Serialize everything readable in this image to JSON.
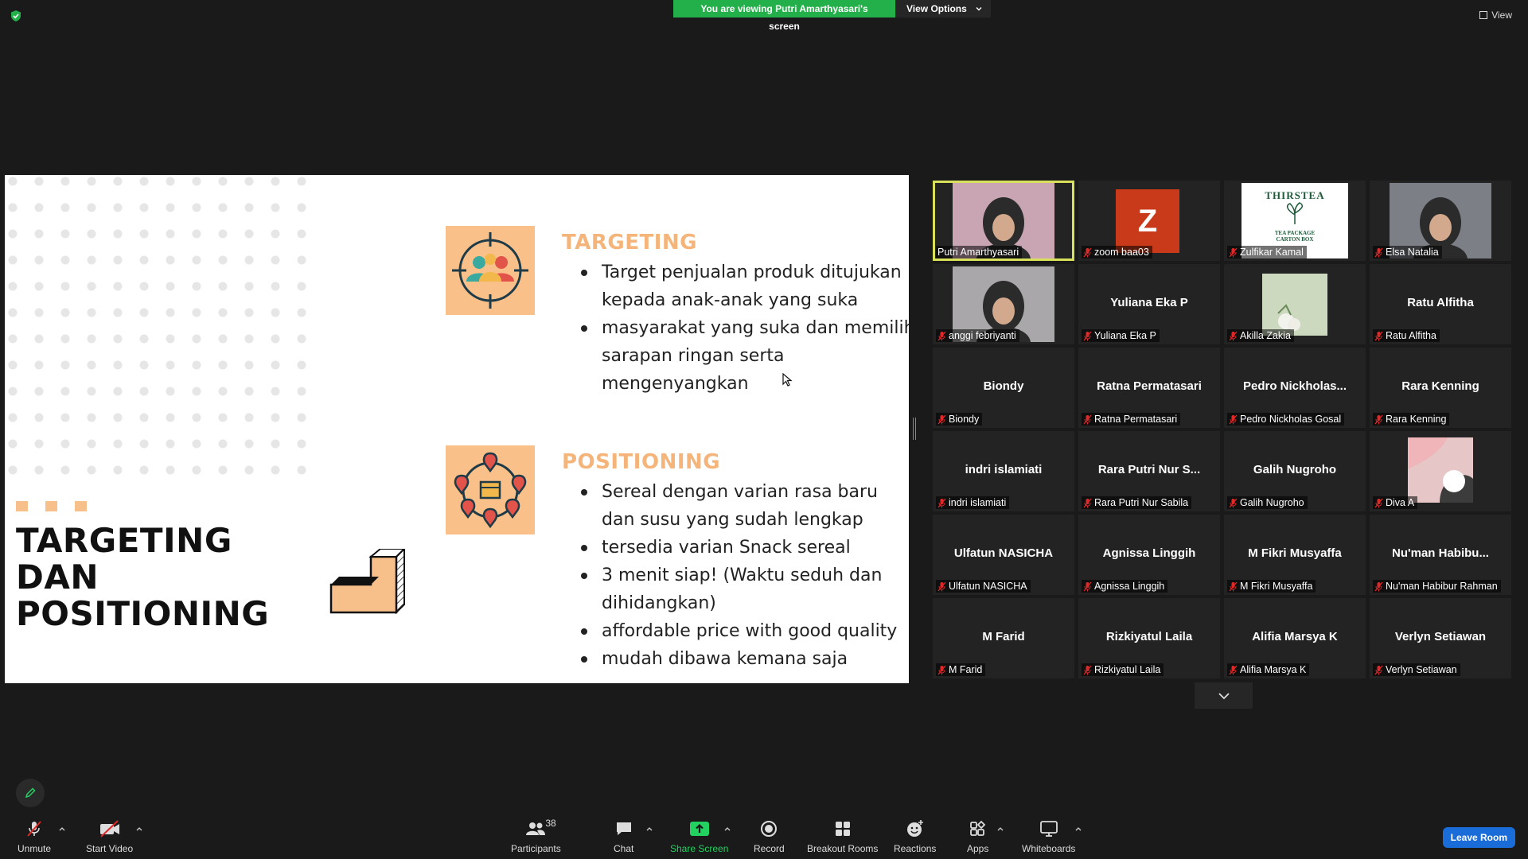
{
  "banner": {
    "viewing_text": "You are viewing Putri Amarthyasari's screen",
    "view_options_label": "View Options"
  },
  "top_right": {
    "view_label": "View"
  },
  "slide": {
    "title": "TARGETING DAN POSITIONING",
    "sections": [
      {
        "heading": "TARGETING",
        "bullets": [
          "Target penjualan produk ditujukan kepada anak-anak yang suka",
          "masyarakat yang suka dan memilih sarapan ringan serta mengenyangkan"
        ]
      },
      {
        "heading": "POSITIONING",
        "bullets": [
          "Sereal dengan varian rasa baru dan susu yang sudah lengkap",
          "tersedia varian Snack sereal",
          "3 menit siap! (Waktu seduh dan dihidangkan)",
          "affordable price with good quality",
          "mudah dibawa kemana saja"
        ]
      }
    ]
  },
  "participants": [
    {
      "label": "Putri Amarthyasari",
      "kind": "video",
      "active": true
    },
    {
      "label": "zoom baa03",
      "kind": "avatar",
      "avatar": "Z"
    },
    {
      "label": "Zulfikar Kamal",
      "kind": "image"
    },
    {
      "label": "Elsa Natalia",
      "kind": "video"
    },
    {
      "label": "anggi febriyanti",
      "kind": "video"
    },
    {
      "label": "Yuliana Eka P",
      "big": "Yuliana Eka P",
      "kind": "name"
    },
    {
      "label": "Akilla Zakia",
      "kind": "image2"
    },
    {
      "label": "Ratu Alfitha",
      "big": "Ratu Alfitha",
      "kind": "name"
    },
    {
      "label": "Biondy",
      "big": "Biondy",
      "kind": "name"
    },
    {
      "label": "Ratna Permatasari",
      "big": "Ratna Permatasari",
      "kind": "name"
    },
    {
      "label": "Pedro Nickholas Gosal",
      "big": "Pedro  Nickholas...",
      "kind": "name"
    },
    {
      "label": "Rara Kenning",
      "big": "Rara Kenning",
      "kind": "name"
    },
    {
      "label": "indri islamiati",
      "big": "indri islamiati",
      "kind": "name"
    },
    {
      "label": "Rara Putri Nur Sabila",
      "big": "Rara Putri Nur S...",
      "kind": "name"
    },
    {
      "label": "Galih Nugroho",
      "big": "Galih Nugroho",
      "kind": "name"
    },
    {
      "label": "Diva A",
      "kind": "image3"
    },
    {
      "label": "Ulfatun NASICHA",
      "big": "Ulfatun NASICHA",
      "kind": "name"
    },
    {
      "label": "Agnissa Linggih",
      "big": "Agnissa Linggih",
      "kind": "name"
    },
    {
      "label": "M Fikri Musyaffa",
      "big": "M Fikri Musyaffa",
      "kind": "name"
    },
    {
      "label": "Nu'man Habibur Rahman",
      "big": "Nu'man  Habibu...",
      "kind": "name"
    },
    {
      "label": "M Farid",
      "big": "M Farid",
      "kind": "name"
    },
    {
      "label": "Rizkiyatul Laila",
      "big": "Rizkiyatul Laila",
      "kind": "name"
    },
    {
      "label": "Alifia Marsya K",
      "big": "Alifia Marsya K",
      "kind": "name"
    },
    {
      "label": "Verlyn Setiawan",
      "big": "Verlyn Setiawan",
      "kind": "name"
    }
  ],
  "zulfikar_logo_text": "THIRSTEA",
  "zulfikar_logo_sub": "TEA PACKAGE CARTON BOX",
  "toolbar": {
    "unmute": "Unmute",
    "start_video": "Start Video",
    "participants": "Participants",
    "participants_count": "38",
    "chat": "Chat",
    "share_screen": "Share Screen",
    "record": "Record",
    "breakout_rooms": "Breakout Rooms",
    "reactions": "Reactions",
    "apps": "Apps",
    "whiteboards": "Whiteboards",
    "leave_room": "Leave Room"
  },
  "colors": {
    "share_green": "#23b04a",
    "accent_peach": "#f9c08a",
    "leave_blue": "#1a6cd8",
    "active_speaker": "#d9e05a"
  }
}
